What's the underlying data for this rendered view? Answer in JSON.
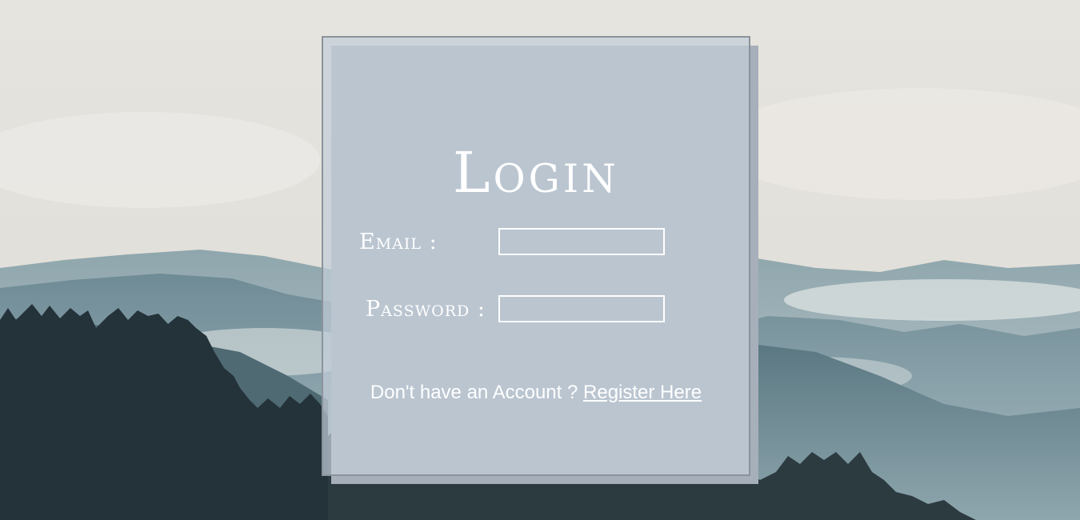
{
  "login": {
    "title": "Login",
    "email_label": "Email :",
    "email_value": "",
    "password_label": "Password :",
    "password_value": "",
    "register_prompt": "Don't have an Account ?",
    "register_link": "Register Here"
  },
  "colors": {
    "sky": "#e8e6e1",
    "mountains": "#7f9aa3",
    "forest": "#243239",
    "card_bg": "#c2cdd8",
    "card_border": "#8b939b",
    "card_shadow": "#a7afba",
    "text": "#ffffff"
  }
}
